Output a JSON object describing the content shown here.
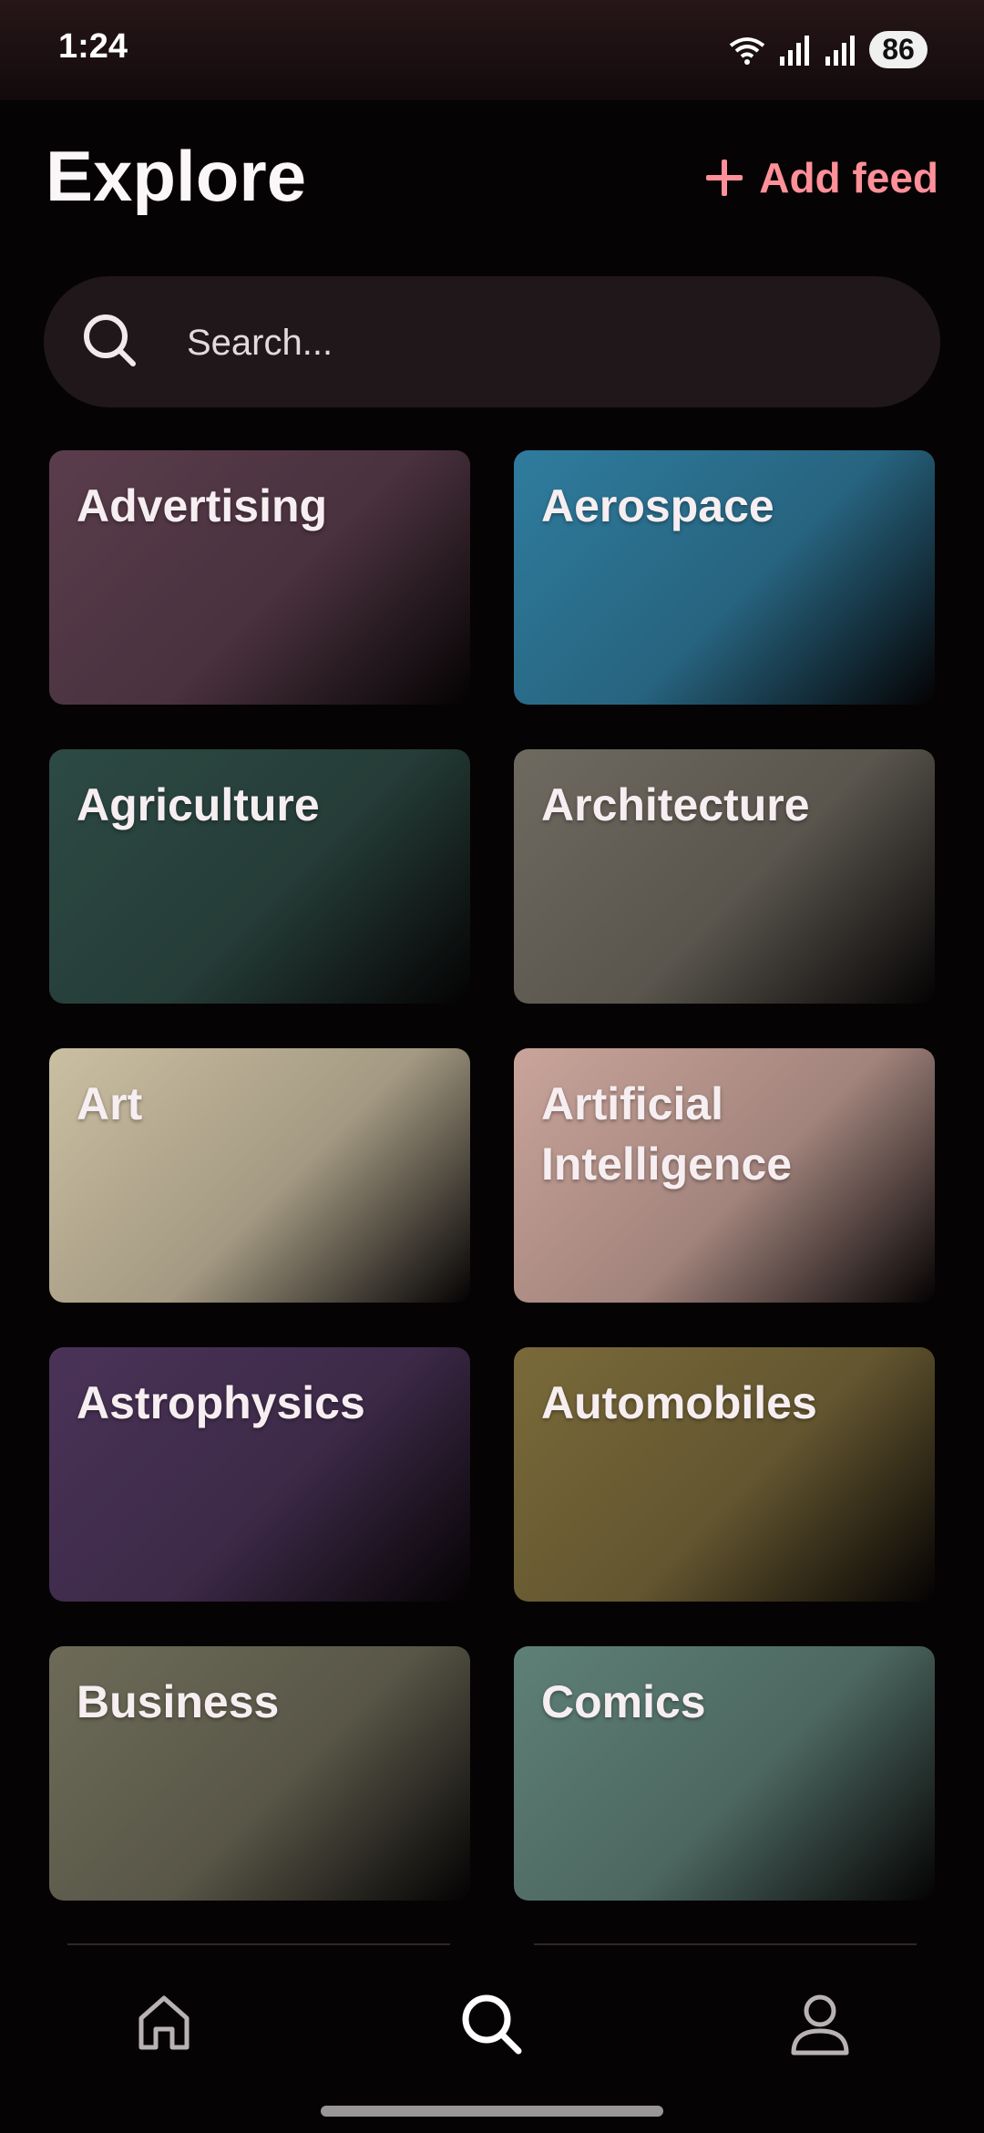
{
  "status_bar": {
    "time": "1:24",
    "battery": "86",
    "icons": [
      "wifi-icon",
      "signal-icon",
      "signal-icon"
    ]
  },
  "header": {
    "title": "Explore",
    "add_feed_label": "Add feed"
  },
  "search": {
    "placeholder": "Search..."
  },
  "categories": [
    {
      "label": "Advertising",
      "color": "#5a3d4c"
    },
    {
      "label": "Aerospace",
      "color": "#2f7c9e"
    },
    {
      "label": "Agriculture",
      "color": "#2d4a44"
    },
    {
      "label": "Architecture",
      "color": "#6e6a60"
    },
    {
      "label": "Art",
      "color": "#cbbfa2"
    },
    {
      "label": "Artificial Intelligence",
      "color": "#c9a49a"
    },
    {
      "label": "Astrophysics",
      "color": "#4a3358"
    },
    {
      "label": "Automobiles",
      "color": "#7a6a3a"
    },
    {
      "label": "Business",
      "color": "#6d6b58"
    },
    {
      "label": "Comics",
      "color": "#5e8077"
    }
  ],
  "bottom_nav": {
    "items": [
      "home-icon",
      "search-icon",
      "profile-icon"
    ],
    "active": "search-icon"
  },
  "colors": {
    "accent": "#ff8f98",
    "background": "#060304",
    "search_background": "#1f1719"
  }
}
